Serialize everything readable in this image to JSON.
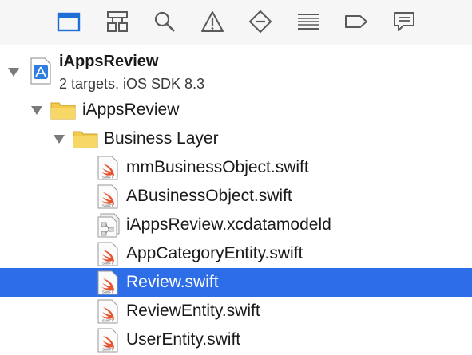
{
  "toolbar": {
    "buttons": [
      {
        "name": "project-navigator",
        "icon": "folder-icon",
        "active": true
      },
      {
        "name": "symbol-navigator",
        "icon": "hierarchy-icon"
      },
      {
        "name": "find-navigator",
        "icon": "search-icon"
      },
      {
        "name": "issue-navigator",
        "icon": "warning-icon"
      },
      {
        "name": "test-navigator",
        "icon": "diamond-minus-icon"
      },
      {
        "name": "debug-navigator",
        "icon": "list-lines-icon"
      },
      {
        "name": "breakpoint-navigator",
        "icon": "breakpoint-tag-icon"
      },
      {
        "name": "report-navigator",
        "icon": "speech-bubble-icon"
      }
    ],
    "active_color": "#1f6fd6",
    "icon_color": "#5a5a5a"
  },
  "project": {
    "name": "iAppsReview",
    "subtitle": "2 targets, iOS SDK 8.3"
  },
  "tree": {
    "group": "iAppsReview",
    "subgroup": "Business Layer",
    "files": [
      {
        "label": "mmBusinessObject.swift",
        "type": "swift"
      },
      {
        "label": "ABusinessObject.swift",
        "type": "swift"
      },
      {
        "label": "iAppsReview.xcdatamodeld",
        "type": "datamodel"
      },
      {
        "label": "AppCategoryEntity.swift",
        "type": "swift"
      },
      {
        "label": "Review.swift",
        "type": "swift",
        "selected": true
      },
      {
        "label": "ReviewEntity.swift",
        "type": "swift"
      },
      {
        "label": "UserEntity.swift",
        "type": "swift"
      }
    ]
  },
  "colors": {
    "selection": "#2d6ee8",
    "folder": "#f2c94c",
    "swift": "#e8532f"
  }
}
